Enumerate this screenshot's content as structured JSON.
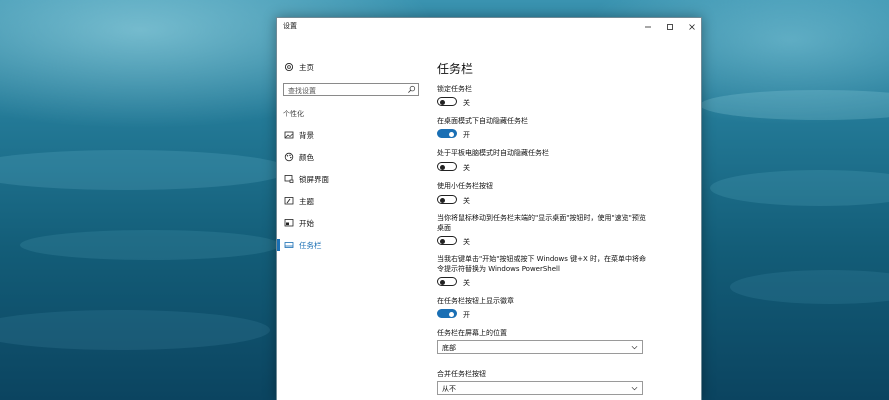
{
  "window": {
    "title": "设置"
  },
  "sidebar": {
    "home_label": "主页",
    "search_placeholder": "查找设置",
    "section": "个性化",
    "items": [
      {
        "label": "背景",
        "icon": "picture-icon"
      },
      {
        "label": "颜色",
        "icon": "palette-icon"
      },
      {
        "label": "锁屏界面",
        "icon": "lock-screen-icon"
      },
      {
        "label": "主题",
        "icon": "theme-icon"
      },
      {
        "label": "开始",
        "icon": "start-icon"
      },
      {
        "label": "任务栏",
        "icon": "taskbar-icon",
        "active": true
      }
    ]
  },
  "main": {
    "title": "任务栏",
    "settings": [
      {
        "label": "锁定任务栏",
        "state": "关",
        "on": false
      },
      {
        "label": "在桌面模式下自动隐藏任务栏",
        "state": "开",
        "on": true
      },
      {
        "label": "处于平板电脑模式时自动隐藏任务栏",
        "state": "关",
        "on": false
      },
      {
        "label": "使用小任务栏按钮",
        "state": "关",
        "on": false
      },
      {
        "label": "当你将鼠标移动到任务栏末端的\"显示桌面\"按钮时，使用\"速览\"预览桌面",
        "state": "关",
        "on": false
      },
      {
        "label": "当我右键单击\"开始\"按钮或按下 Windows 键+X 时，在菜单中将命令提示符替换为 Windows PowerShell",
        "state": "关",
        "on": false
      },
      {
        "label": "在任务栏按钮上显示徽章",
        "state": "开",
        "on": true
      }
    ],
    "dropdowns": [
      {
        "label": "任务栏在屏幕上的位置",
        "value": "底部"
      },
      {
        "label": "合并任务栏按钮",
        "value": "从不"
      }
    ]
  },
  "colors": {
    "accent": "#1a6fb4"
  }
}
